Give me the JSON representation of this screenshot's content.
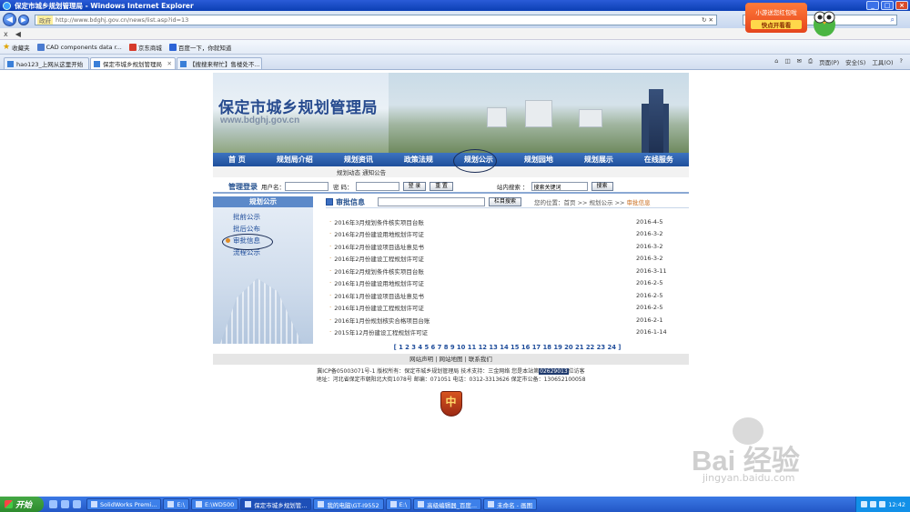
{
  "browser": {
    "title": "保定市城乡规划管理局 - Windows Internet Explorer",
    "address_url": "http://www.bdghj.gov.cn/news/list.asp?id=13",
    "address_prefix": "政府",
    "menu": [
      "x",
      "◀"
    ],
    "favorites_label": "收藏夹",
    "favorites": [
      "CAD components data r...",
      "京东商城",
      "百度一下，你就知道"
    ],
    "tabs": [
      {
        "label": "hao123_上网从这里开始",
        "active": false
      },
      {
        "label": "保定市城乡规划管理局",
        "active": true
      },
      {
        "label": "【搜搜来帮忙】售楼处不...",
        "active": false
      }
    ],
    "tools": [
      "页面(P)",
      "安全(S)",
      "工具(O)"
    ]
  },
  "notify": {
    "line1": "小游送您红包啦",
    "line2": "快点开看看"
  },
  "site": {
    "title": "保定市城乡规划管理局",
    "url": "www.bdghj.gov.cn",
    "nav": [
      "首 页",
      "规划局介绍",
      "规划资讯",
      "政策法规",
      "规划公示",
      "规划园地",
      "规划展示",
      "在线服务"
    ],
    "subnav": "规划动态 通知公告",
    "login": {
      "title": "管理登录",
      "user_label": "用户名：",
      "pass_label": "密 码：",
      "login_btn": "登 录",
      "reset_btn": "重 置",
      "search_label": "站内搜索 ：",
      "search_value": "搜索关键词",
      "search_btn": "搜索"
    },
    "sidebar": {
      "title": "规划公示",
      "items": [
        "批前公示",
        "批后公布",
        "审批信息",
        "流程公示"
      ]
    },
    "main": {
      "title": "审批信息",
      "search_btn": "栏目搜索",
      "crumb_prefix": "您的位置：首页 >> 规划公示 >> ",
      "crumb_current": "审批信息"
    },
    "list": [
      {
        "title": "2016年3月规划条件核实项目台账",
        "date": "2016-4-5"
      },
      {
        "title": "2016年2月份建设用地规划许可证",
        "date": "2016-3-2"
      },
      {
        "title": "2016年2月份建设项目选址意见书",
        "date": "2016-3-2"
      },
      {
        "title": "2016年2月份建设工程规划许可证",
        "date": "2016-3-2"
      },
      {
        "title": "2016年2月规划条件核实项目台账",
        "date": "2016-3-11"
      },
      {
        "title": "2016年1月份建设用地规划许可证",
        "date": "2016-2-5"
      },
      {
        "title": "2016年1月份建设项目选址意见书",
        "date": "2016-2-5"
      },
      {
        "title": "2016年1月份建设工程规划许可证",
        "date": "2016-2-5"
      },
      {
        "title": "2016年1月份规划核实合格项目台账",
        "date": "2016-2-1"
      },
      {
        "title": "2015年12月份建设工程规划许可证",
        "date": "2016-1-14"
      }
    ],
    "pager": "[ 1 2 3 4 5 6 7 8 9 10 11 12 13 14 15 16 17 18 19 20 21 22 23 24 ]",
    "footer_links": "网站声明  |  网站地图  |  联系我们",
    "footer_line1_a": "冀ICP备05003071号-1    版权所有：保定市城乡规划管理局    技术支持：三金网络    您是本站第",
    "footer_counter": "02629013",
    "footer_line1_b": "位访客",
    "footer_line2": "地址：河北省保定市朝阳北大街1078号    邮编：071051    电话：0312-3313626    保定市公备：130652100058",
    "badge_text": "中"
  },
  "watermark": {
    "main": "Bai 经验",
    "url": "jingyan.baidu.com"
  },
  "taskbar": {
    "start": "开始",
    "items": [
      "SolidWorks Premi...",
      "E:\\",
      "E:\\WD500",
      "保定市城乡规划管...",
      "我的电脑\\GT-I9552",
      "E:\\",
      "高级编辑器_百度...",
      "未命名 - 画图"
    ],
    "active_index": 3,
    "clock": "12:42"
  }
}
